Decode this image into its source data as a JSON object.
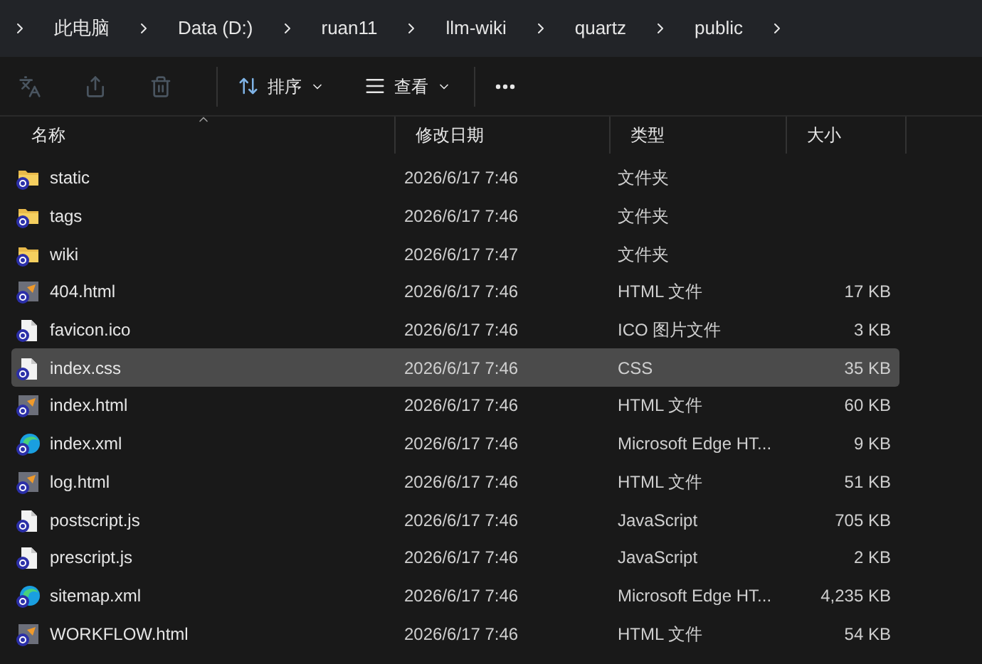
{
  "breadcrumb": [
    {
      "label": "此电脑"
    },
    {
      "label": "Data (D:)"
    },
    {
      "label": "ruan11"
    },
    {
      "label": "llm-wiki"
    },
    {
      "label": "quartz"
    },
    {
      "label": "public"
    }
  ],
  "toolbar": {
    "icon_buttons": [
      {
        "kind": "rename",
        "disabled": true
      },
      {
        "kind": "share",
        "disabled": true
      },
      {
        "kind": "delete",
        "disabled": true
      }
    ],
    "sort": "排序",
    "view": "查看"
  },
  "columns": [
    {
      "label": "名称",
      "sorted": true
    },
    {
      "label": "修改日期",
      "sorted": false
    },
    {
      "label": "类型",
      "sorted": false
    },
    {
      "label": "大小",
      "sorted": false
    }
  ],
  "rows": [
    {
      "name": "static",
      "kind": "folder",
      "date": "2026/6/17 7:46",
      "type": "文件夹",
      "selected": false
    },
    {
      "name": "tags",
      "kind": "folder",
      "date": "2026/6/17 7:46",
      "type": "文件夹",
      "selected": false
    },
    {
      "name": "wiki",
      "kind": "folder",
      "date": "2026/6/17 7:47",
      "type": "文件夹",
      "selected": false
    },
    {
      "name": "404.html",
      "kind": "html",
      "date": "2026/6/17 7:46",
      "type": "HTML 文件",
      "size": "17 KB",
      "selected": false
    },
    {
      "name": "favicon.ico",
      "kind": "file",
      "date": "2026/6/17 7:46",
      "type": "ICO 图片文件",
      "size": "3 KB",
      "selected": false
    },
    {
      "name": "index.css",
      "kind": "file",
      "date": "2026/6/17 7:46",
      "type": "CSS",
      "size": "35 KB",
      "selected": true
    },
    {
      "name": "index.html",
      "kind": "html",
      "date": "2026/6/17 7:46",
      "type": "HTML 文件",
      "size": "60 KB",
      "selected": false
    },
    {
      "name": "index.xml",
      "kind": "edge",
      "date": "2026/6/17 7:46",
      "type": "Microsoft Edge HT...",
      "size": "9 KB",
      "selected": false
    },
    {
      "name": "log.html",
      "kind": "html",
      "date": "2026/6/17 7:46",
      "type": "HTML 文件",
      "size": "51 KB",
      "selected": false
    },
    {
      "name": "postscript.js",
      "kind": "file",
      "date": "2026/6/17 7:46",
      "type": "JavaScript",
      "size": "705 KB",
      "selected": false
    },
    {
      "name": "prescript.js",
      "kind": "file",
      "date": "2026/6/17 7:46",
      "type": "JavaScript",
      "size": "2 KB",
      "selected": false
    },
    {
      "name": "sitemap.xml",
      "kind": "edge",
      "date": "2026/6/17 7:46",
      "type": "Microsoft Edge HT...",
      "size": "4,235 KB",
      "selected": false
    },
    {
      "name": "WORKFLOW.html",
      "kind": "html",
      "date": "2026/6/17 7:46",
      "type": "HTML 文件",
      "size": "54 KB",
      "selected": false
    }
  ]
}
